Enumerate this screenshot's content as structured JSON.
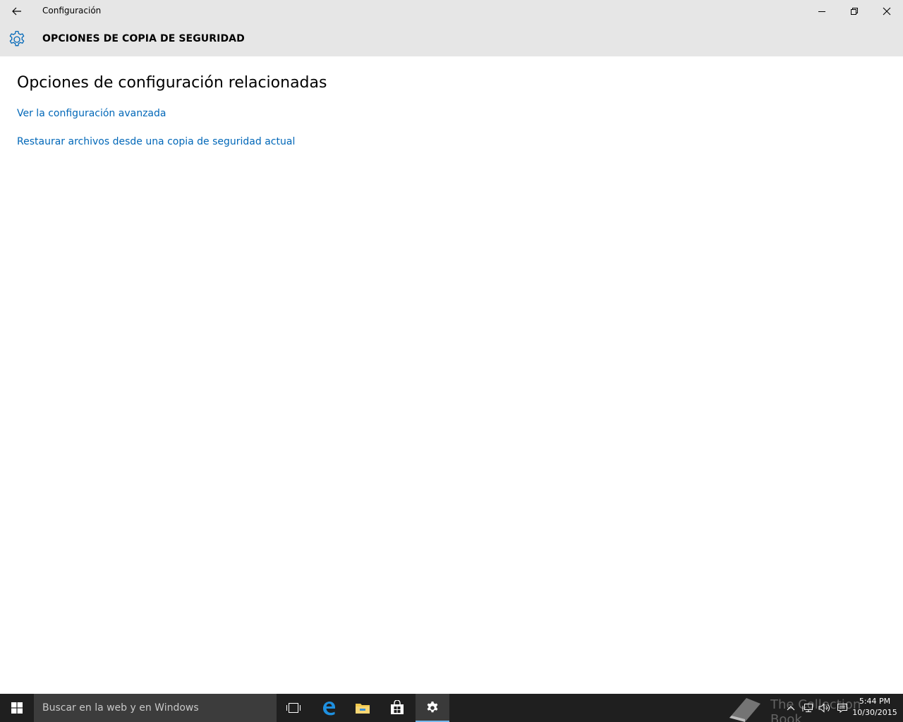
{
  "window": {
    "title": "Configuración"
  },
  "header": {
    "title": "OPCIONES DE COPIA DE SEGURIDAD",
    "icon": "gear-icon"
  },
  "content": {
    "section_title": "Opciones de configuración relacionadas",
    "links": [
      {
        "label": "Ver la configuración avanzada"
      },
      {
        "label": "Restaurar archivos desde una copia de seguridad actual"
      }
    ]
  },
  "taskbar": {
    "search_placeholder": "Buscar en la web y en Windows",
    "apps": [
      "task-view-icon",
      "edge-icon",
      "file-explorer-icon",
      "store-icon",
      "settings-icon"
    ],
    "active_app": "settings-icon"
  },
  "watermark": {
    "text": "The Collection Book"
  },
  "clock": {
    "time": "5:44 PM",
    "date": "10/30/2015"
  },
  "colors": {
    "link": "#0067b8",
    "header_bg": "#e6e6e6",
    "taskbar_bg": "#1f1f1f",
    "accent": "#76b9ed"
  }
}
